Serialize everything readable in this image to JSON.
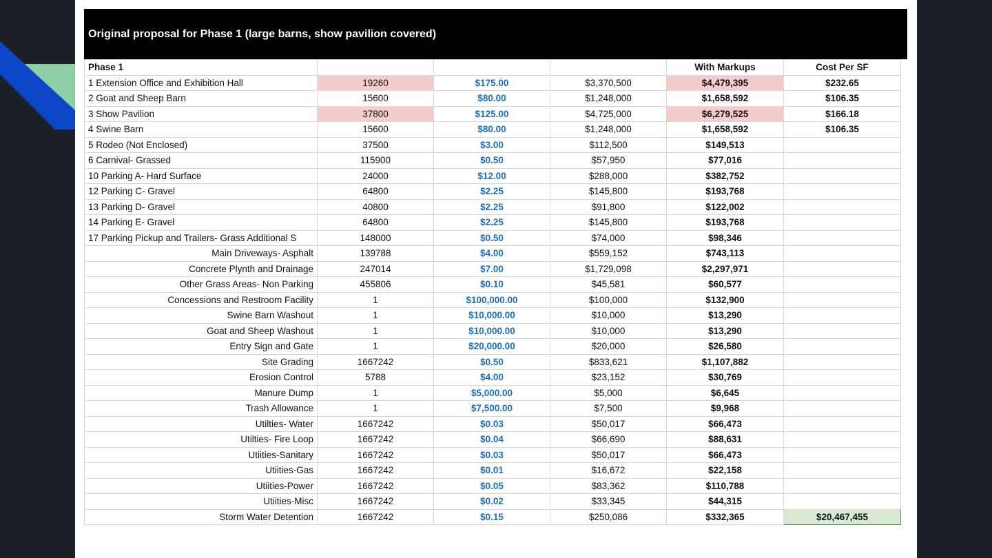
{
  "title": "Original proposal for Phase 1 (large barns, show pavilion covered)",
  "header": [
    "Phase 1",
    "",
    "",
    "",
    "With Markups",
    "Cost Per SF"
  ],
  "rows": [
    {
      "name": "1 Extension Office and Exhibition Hall",
      "qty": "19260",
      "rate": "$175.00",
      "cost": "$3,370,500",
      "markup": "$4,479,395",
      "psf": "$232.65"
    },
    {
      "name": "2 Goat and Sheep Barn",
      "qty": "15600",
      "rate": "$80.00",
      "cost": "$1,248,000",
      "markup": "$1,658,592",
      "psf": "$106.35"
    },
    {
      "name": "3 Show Pavilion",
      "qty": "37800",
      "rate": "$125.00",
      "cost": "$4,725,000",
      "markup": "$6,279,525",
      "psf": "$166.18"
    },
    {
      "name": "4 Swine Barn",
      "qty": "15600",
      "rate": "$80.00",
      "cost": "$1,248,000",
      "markup": "$1,658,592",
      "psf": "$106.35"
    },
    {
      "name": "5 Rodeo (Not Enclosed)",
      "qty": "37500",
      "rate": "$3.00",
      "cost": "$112,500",
      "markup": "$149,513",
      "psf": ""
    },
    {
      "name": "6 Carnival- Grassed",
      "qty": "115900",
      "rate": "$0.50",
      "cost": "$57,950",
      "markup": "$77,016",
      "psf": ""
    },
    {
      "name": "10 Parking A- Hard Surface",
      "qty": "24000",
      "rate": "$12.00",
      "cost": "$288,000",
      "markup": "$382,752",
      "psf": ""
    },
    {
      "name": "12 Parking C- Gravel",
      "qty": "64800",
      "rate": "$2.25",
      "cost": "$145,800",
      "markup": "$193,768",
      "psf": ""
    },
    {
      "name": "13 Parking D- Gravel",
      "qty": "40800",
      "rate": "$2.25",
      "cost": "$91,800",
      "markup": "$122,002",
      "psf": ""
    },
    {
      "name": "14 Parking E- Gravel",
      "qty": "64800",
      "rate": "$2.25",
      "cost": "$145,800",
      "markup": "$193,768",
      "psf": ""
    },
    {
      "name": "17 Parking Pickup and Trailers- Grass Additional S",
      "qty": "148000",
      "rate": "$0.50",
      "cost": "$74,000",
      "markup": "$98,346",
      "psf": ""
    },
    {
      "name": "Main Driveways- Asphalt",
      "qty": "139788",
      "rate": "$4.00",
      "cost": "$559,152",
      "markup": "$743,113",
      "psf": ""
    },
    {
      "name": "Concrete Plynth and Drainage",
      "qty": "247014",
      "rate": "$7.00",
      "cost": "$1,729,098",
      "markup": "$2,297,971",
      "psf": ""
    },
    {
      "name": "Other Grass Areas- Non Parking",
      "qty": "455806",
      "rate": "$0.10",
      "cost": "$45,581",
      "markup": "$60,577",
      "psf": ""
    },
    {
      "name": "Concessions and Restroom Facility",
      "qty": "1",
      "rate": "$100,000.00",
      "cost": "$100,000",
      "markup": "$132,900",
      "psf": ""
    },
    {
      "name": "Swine Barn Washout",
      "qty": "1",
      "rate": "$10,000.00",
      "cost": "$10,000",
      "markup": "$13,290",
      "psf": ""
    },
    {
      "name": "Goat and Sheep Washout",
      "qty": "1",
      "rate": "$10,000.00",
      "cost": "$10,000",
      "markup": "$13,290",
      "psf": ""
    },
    {
      "name": "Entry Sign and Gate",
      "qty": "1",
      "rate": "$20,000.00",
      "cost": "$20,000",
      "markup": "$26,580",
      "psf": ""
    },
    {
      "name": "Site Grading",
      "qty": "1667242",
      "rate": "$0.50",
      "cost": "$833,621",
      "markup": "$1,107,882",
      "psf": ""
    },
    {
      "name": "Erosion Control",
      "qty": "5788",
      "rate": "$4.00",
      "cost": "$23,152",
      "markup": "$30,769",
      "psf": ""
    },
    {
      "name": "Manure Dump",
      "qty": "1",
      "rate": "$5,000.00",
      "cost": "$5,000",
      "markup": "$6,645",
      "psf": ""
    },
    {
      "name": "Trash Allowance",
      "qty": "1",
      "rate": "$7,500.00",
      "cost": "$7,500",
      "markup": "$9,968",
      "psf": ""
    },
    {
      "name": "Utilties- Water",
      "qty": "1667242",
      "rate": "$0.03",
      "cost": "$50,017",
      "markup": "$66,473",
      "psf": ""
    },
    {
      "name": "Utilties- Fire Loop",
      "qty": "1667242",
      "rate": "$0.04",
      "cost": "$66,690",
      "markup": "$88,631",
      "psf": ""
    },
    {
      "name": "Utiities-Sanitary",
      "qty": "1667242",
      "rate": "$0.03",
      "cost": "$50,017",
      "markup": "$66,473",
      "psf": ""
    },
    {
      "name": "Utiities-Gas",
      "qty": "1667242",
      "rate": "$0.01",
      "cost": "$16,672",
      "markup": "$22,158",
      "psf": ""
    },
    {
      "name": "Utiities-Power",
      "qty": "1667242",
      "rate": "$0.05",
      "cost": "$83,362",
      "markup": "$110,788",
      "psf": ""
    },
    {
      "name": "Utiities-Misc",
      "qty": "1667242",
      "rate": "$0.02",
      "cost": "$33,345",
      "markup": "$44,315",
      "psf": ""
    },
    {
      "name": "Storm Water Detention",
      "qty": "1667242",
      "rate": "$0.15",
      "cost": "$250,086",
      "markup": "$332,365",
      "psf": "$20,467,455"
    }
  ],
  "colors": {
    "highlight_pink": "#f4cccc",
    "total_green": "#d9ead3",
    "rate_blue": "#1a6fc0",
    "deco_blue": "#0d47c9",
    "deco_teal": "#8fcfa6"
  }
}
